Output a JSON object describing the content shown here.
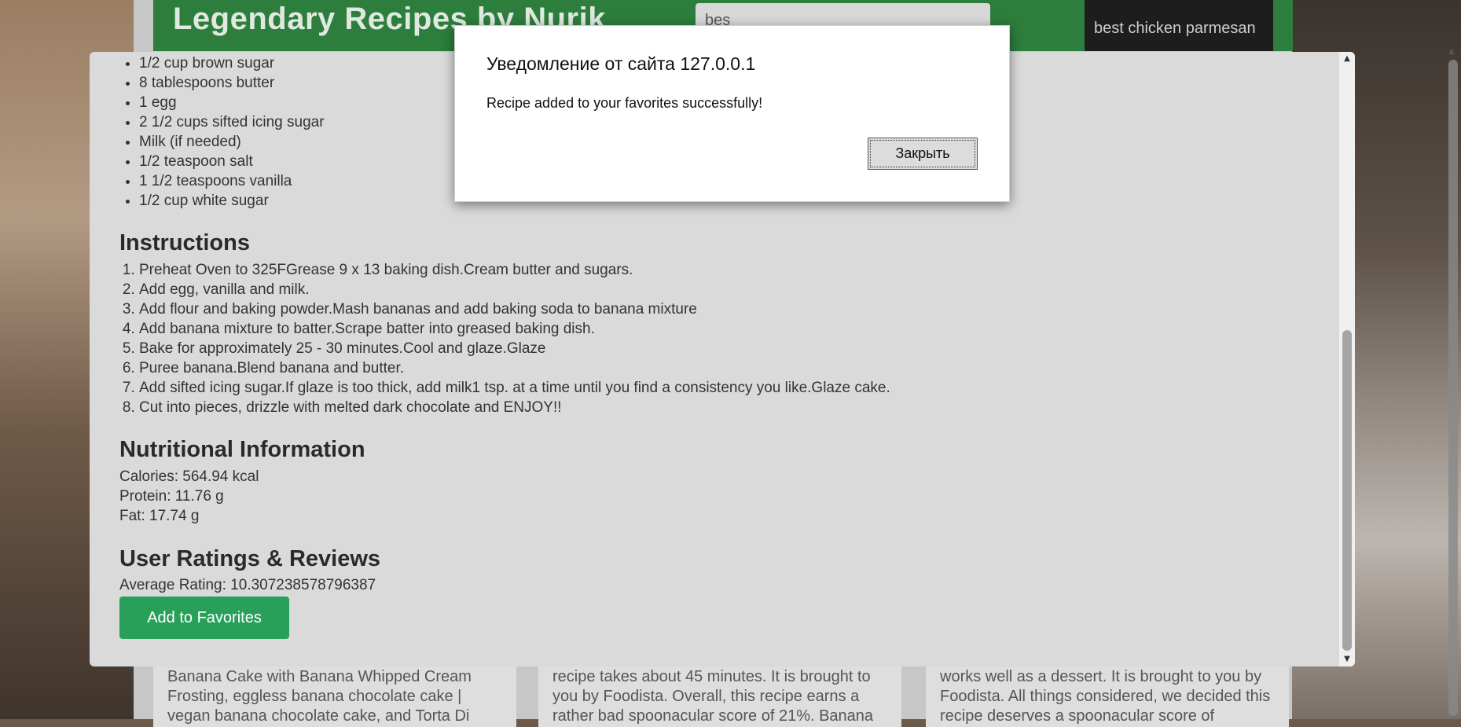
{
  "page": {
    "site_title": "Legendary Recipes by Nurik",
    "search_value": "bes",
    "suggestion": "best chicken parmesan"
  },
  "cards": [
    "Banana Cake with Banana Whipped Cream Frosting, eggless banana chocolate cake | vegan banana chocolate cake, and Torta Di",
    "recipe takes about 45 minutes. It is brought to you by Foodista. Overall, this recipe earns a rather bad spoonacular score of 21%. Banana",
    "works well as a dessert. It is brought to you by Foodista. All things considered, we decided this recipe deserves a spoonacular score of"
  ],
  "modal": {
    "ingredients": [
      "1/2 cup brown sugar",
      "8 tablespoons butter",
      "1 egg",
      "2 1/2 cups sifted icing sugar",
      "Milk (if needed)",
      "1/2 teaspoon salt",
      "1 1/2 teaspoons vanilla",
      "1/2 cup white sugar"
    ],
    "instructions_title": "Instructions",
    "instructions": [
      "Preheat Oven to 325FGrease 9 x 13 baking dish.Cream butter and sugars.",
      "Add egg, vanilla and milk.",
      "Add flour and baking powder.Mash bananas and add baking soda to banana mixture",
      "Add banana mixture to batter.Scrape batter into greased baking dish.",
      "Bake for approximately 25 - 30 minutes.Cool and glaze.Glaze",
      "Puree banana.Blend banana and butter.",
      "Add sifted icing sugar.If glaze is too thick, add milk1 tsp. at a time until you find a consistency you like.Glaze cake.",
      "Cut into pieces, drizzle with melted dark chocolate and ENJOY!!"
    ],
    "nutrition_title": "Nutritional Information",
    "calories": "Calories: 564.94 kcal",
    "protein": "Protein: 11.76 g",
    "fat": "Fat: 17.74 g",
    "ratings_title": "User Ratings & Reviews",
    "average_rating": "Average Rating: 10.307238578796387",
    "favorite_button": "Add to Favorites"
  },
  "dialog": {
    "title": "Уведомление от сайта 127.0.0.1",
    "message": "Recipe added to your favorites successfully!",
    "close_button": "Закрыть"
  },
  "colors": {
    "header_green": "#2d7d3c",
    "button_green": "#28a05a",
    "modal_bg": "#dadada"
  }
}
